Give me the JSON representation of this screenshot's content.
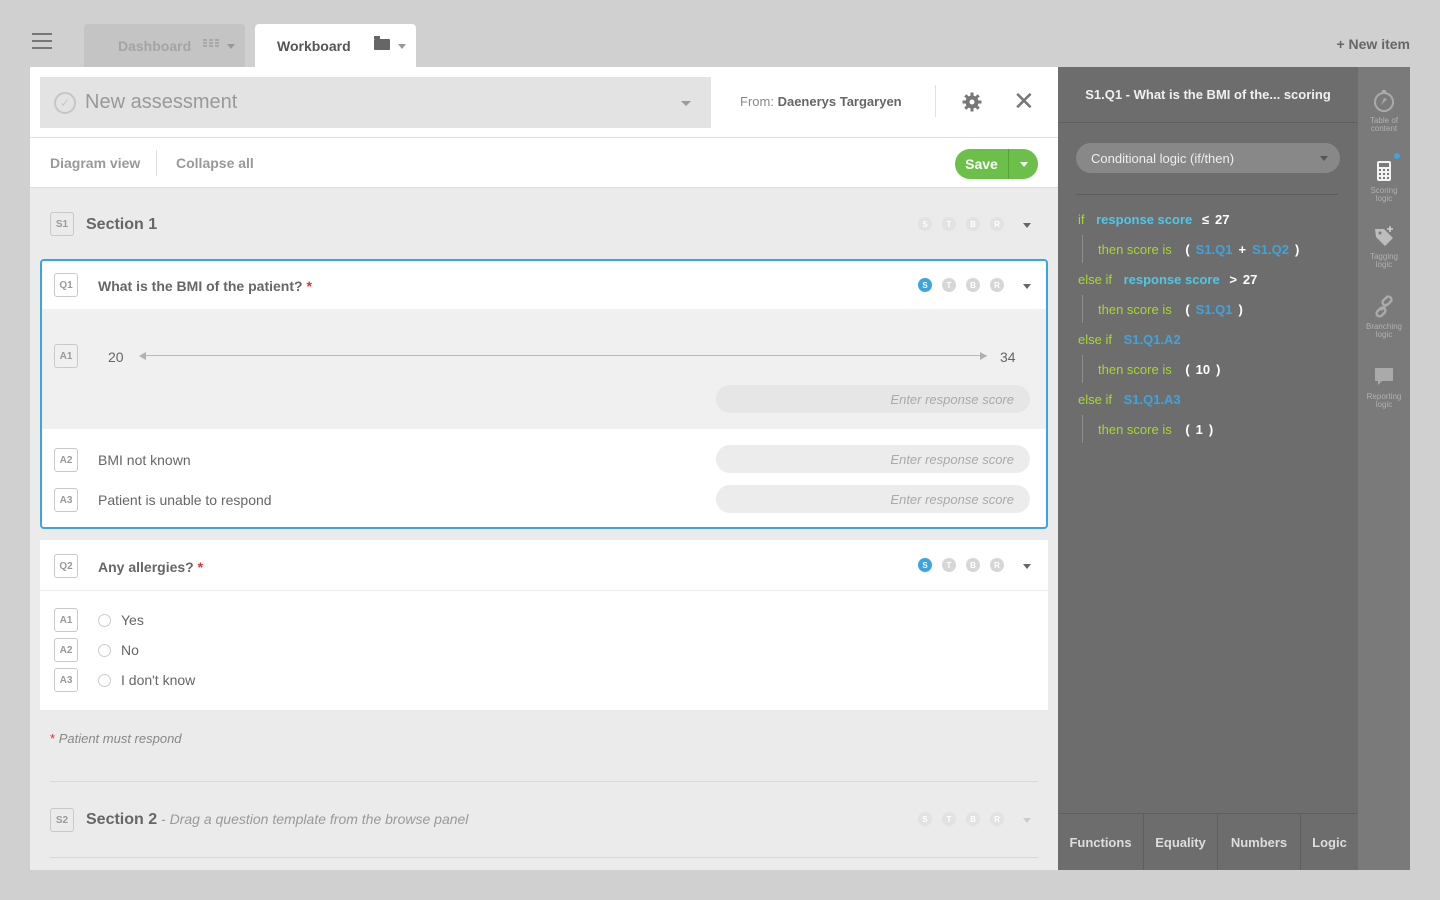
{
  "tabs": [
    {
      "label": "Dashboard",
      "icon": "grid-icon"
    },
    {
      "label": "Workboard",
      "icon": "folder-icon"
    }
  ],
  "new_item_label": "+ New item",
  "header": {
    "title": "New assessment",
    "from_label": "From:",
    "from_name": "Daenerys Targaryen"
  },
  "toolbar": {
    "diagram_view": "Diagram view",
    "collapse_all": "Collapse all",
    "save": "Save"
  },
  "stbr": [
    "S",
    "T",
    "B",
    "R"
  ],
  "sections": [
    {
      "badge": "S1",
      "title": "Section 1",
      "hint": ""
    },
    {
      "badge": "S2",
      "title": "Section 2",
      "hint": " - Drag a question template from the browse panel"
    }
  ],
  "q1": {
    "badge": "Q1",
    "title": "What is the BMI of the patient?",
    "required": "*",
    "a1": {
      "badge": "A1",
      "min": "20",
      "max": "34"
    },
    "a2": {
      "badge": "A2",
      "label": "BMI not known"
    },
    "a3": {
      "badge": "A3",
      "label": "Patient is unable to respond"
    },
    "score_placeholder": "Enter response score"
  },
  "q2": {
    "badge": "Q2",
    "title": "Any allergies?",
    "required": "*",
    "options": [
      {
        "badge": "A1",
        "label": "Yes"
      },
      {
        "badge": "A2",
        "label": "No"
      },
      {
        "badge": "A3",
        "label": "I don't know"
      }
    ]
  },
  "note": {
    "star": "*",
    "text": "Patient must respond"
  },
  "side": {
    "title": "S1.Q1 - What is the BMI of the... scoring",
    "logic_type": "Conditional logic (if/then)",
    "rules": [
      {
        "kw": "if",
        "var": "response score",
        "op": "≤",
        "val": "27"
      },
      {
        "kw": "then score is",
        "open": "(",
        "a": "S1.Q1",
        "plus": "+",
        "b": "S1.Q2",
        "close": ")"
      },
      {
        "kw": "else if",
        "var": "response score",
        "op": ">",
        "val": "27"
      },
      {
        "kw": "then score is",
        "open": "(",
        "a": "S1.Q1",
        "close": ")"
      },
      {
        "kw": "else if",
        "ref": "S1.Q1.A2"
      },
      {
        "kw": "then score is",
        "open": "(",
        "val": "10",
        "close": ")"
      },
      {
        "kw": "else if",
        "ref": "S1.Q1.A3"
      },
      {
        "kw": "then score is",
        "open": "(",
        "val": "1",
        "close": ")"
      }
    ],
    "tabs": [
      "Functions",
      "Equality",
      "Numbers",
      "Logic"
    ]
  },
  "rail": [
    {
      "label1": "Table of",
      "label2": "content",
      "icon": "compass-icon"
    },
    {
      "label1": "Scoring",
      "label2": "logic",
      "icon": "calculator-icon"
    },
    {
      "label1": "Tagging",
      "label2": "logic",
      "icon": "tag-icon"
    },
    {
      "label1": "Branching",
      "label2": "logic",
      "icon": "link-icon"
    },
    {
      "label1": "Reporting",
      "label2": "logic",
      "icon": "speech-bubble-icon"
    }
  ],
  "colors": {
    "accent": "#3da4e0",
    "save_green": "#6cc04a",
    "required_red": "#e0302e",
    "logic_keyword": "#a6d82f"
  }
}
